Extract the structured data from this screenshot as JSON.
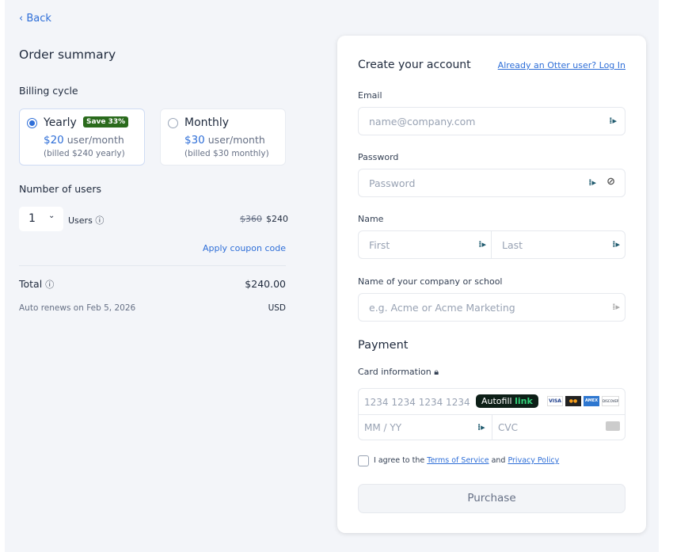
{
  "back": "Back",
  "summary": {
    "title": "Order summary",
    "billing_label": "Billing cycle",
    "yearly": {
      "name": "Yearly",
      "badge": "Save 33%",
      "price": "$20",
      "unit": " user/month",
      "billed": "(billed $240 yearly)",
      "selected": true
    },
    "monthly": {
      "name": "Monthly",
      "price": "$30",
      "unit": " user/month",
      "billed": "(billed $30 monthly)",
      "selected": false
    },
    "users_label": "Number of users",
    "users_value": "1",
    "users_text": "Users",
    "old_price": "$360",
    "price": "$240",
    "coupon": "Apply coupon code",
    "total_label": "Total",
    "total": "$240.00",
    "renews": "Auto renews on Feb 5, 2026",
    "currency": "USD"
  },
  "account": {
    "title": "Create your account",
    "login": "Already an Otter user? Log In",
    "email_label": "Email",
    "email_ph": "name@company.com",
    "password_label": "Password",
    "password_ph": "Password",
    "name_label": "Name",
    "first_ph": "First",
    "last_ph": "Last",
    "company_label": "Name of your company or school",
    "company_ph": "e.g. Acme or Acme Marketing"
  },
  "payment": {
    "title": "Payment",
    "card_label": "Card information",
    "card_ph": "1234 1234 1234 1234",
    "autofill": "Autofill",
    "link": "link",
    "brands": [
      "VISA",
      "MC",
      "AMEX",
      "DISCOVER"
    ],
    "exp_ph": "MM / YY",
    "cvc_ph": "CVC",
    "agree_pre": "I agree to the ",
    "tos": "Terms of Service",
    "and": " and ",
    "privacy": "Privacy Policy",
    "purchase": "Purchase"
  }
}
